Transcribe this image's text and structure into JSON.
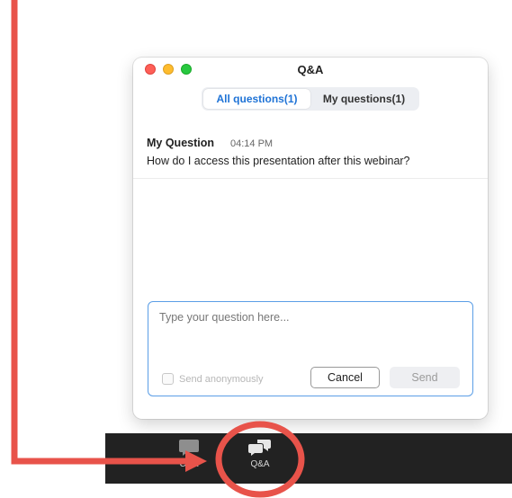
{
  "window": {
    "title": "Q&A"
  },
  "tabs": [
    {
      "label": "All questions(1)",
      "active": true
    },
    {
      "label": "My questions(1)",
      "active": false
    }
  ],
  "question": {
    "author": "My Question",
    "time": "04:14 PM",
    "text": "How do I access this presentation after this webinar?"
  },
  "compose": {
    "placeholder": "Type your question here...",
    "anonymous_label": "Send anonymously",
    "anonymous_checked": false,
    "cancel_label": "Cancel",
    "send_label": "Send"
  },
  "toolbar": {
    "items": [
      {
        "label": "Chat",
        "icon": "chat-bubble-icon"
      },
      {
        "label": "Q&A",
        "icon": "qa-bubbles-icon"
      }
    ]
  },
  "annotation": {
    "color": "#e8534a"
  },
  "colors": {
    "accent": "#1f73d6",
    "input_border": "#5b9ee6",
    "toolbar_bg": "#222222"
  }
}
